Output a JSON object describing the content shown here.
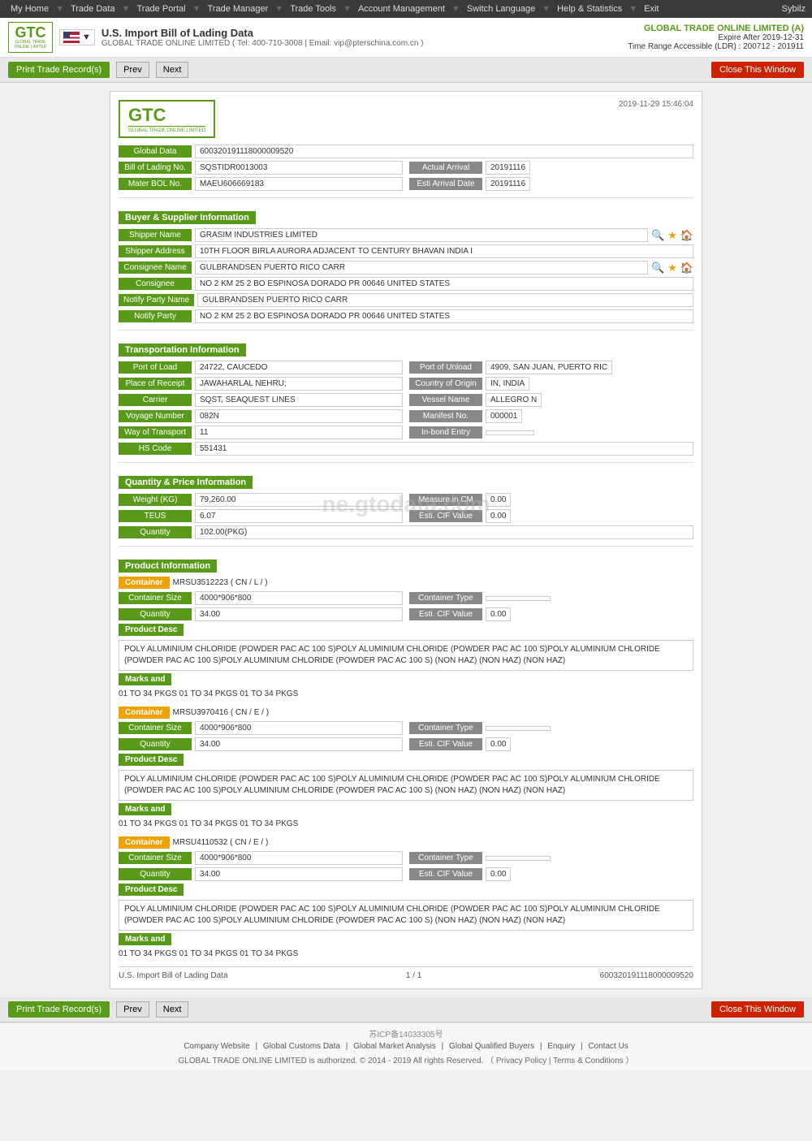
{
  "nav": {
    "items": [
      "My Home",
      "Trade Data",
      "Trade Portal",
      "Trade Manager",
      "Trade Tools",
      "Account Management",
      "Switch Language",
      "Help & Statistics",
      "Exit"
    ],
    "user": "Sybilz"
  },
  "header": {
    "logo_text": "GTC",
    "logo_sub": "GLOBAL TRADE ONLINE LIMITED",
    "title": "U.S. Import Bill of Lading Data",
    "subtitle": "GLOBAL TRADE ONLINE LIMITED ( Tel: 400-710-3008 | Email: vip@pterschina.com.cn )",
    "account_label": "GLOBAL TRADE ONLINE LIMITED (A)",
    "expire_label": "Expire After 2019-12-31",
    "time_range_label": "Time Range Accessible (LDR) : 200712 - 201911"
  },
  "toolbar": {
    "print_label": "Print Trade Record(s)",
    "prev_label": "Prev",
    "next_label": "Next",
    "close_label": "Close This Window"
  },
  "card": {
    "timestamp": "2019-11-29 15:46:04",
    "global_data_label": "Global Data",
    "global_data_value": "600320191118000009520",
    "bill_of_lading_label": "Bill of Lading No.",
    "bill_of_lading_value": "SQSTIDR0013003",
    "actual_arrival_label": "Actual Arrival",
    "actual_arrival_value": "20191116",
    "mater_bol_label": "Mater BOL No.",
    "mater_bol_value": "MAEU606669183",
    "esti_arrival_label": "Esti Arrival Date",
    "esti_arrival_value": "20191116",
    "buyer_supplier_section": "Buyer & Supplier Information",
    "shipper_name_label": "Shipper Name",
    "shipper_name_value": "GRASIM INDUSTRIES LIMITED",
    "shipper_address_label": "Shipper Address",
    "shipper_address_value": "10TH FLOOR BIRLA AURORA ADJACENT TO CENTURY BHAVAN INDIA I",
    "consignee_name_label": "Consignee Name",
    "consignee_name_value": "GULBRANDSEN PUERTO RICO CARR",
    "consignee_label": "Consignee",
    "consignee_value": "NO 2 KM 25 2 BO ESPINOSA DORADO PR 00646 UNITED STATES",
    "notify_party_name_label": "Notify Party Name",
    "notify_party_name_value": "GULBRANDSEN PUERTO RICO CARR",
    "notify_party_label": "Notify Party",
    "notify_party_value": "NO 2 KM 25 2 BO ESPINOSA DORADO PR 00646 UNITED STATES",
    "transport_section": "Transportation Information",
    "port_of_load_label": "Port of Load",
    "port_of_load_value": "24722, CAUCEDO",
    "port_of_unload_label": "Port of Unload",
    "port_of_unload_value": "4909, SAN JUAN, PUERTO RIC",
    "place_of_receipt_label": "Place of Receipt",
    "place_of_receipt_value": "JAWAHARLAL NEHRU;",
    "country_of_origin_label": "Country of Origin",
    "country_of_origin_value": "IN, INDIA",
    "carrier_label": "Carrier",
    "carrier_value": "SQST, SEAQUEST LINES",
    "vessel_name_label": "Vessel Name",
    "vessel_name_value": "ALLEGRO N",
    "voyage_number_label": "Voyage Number",
    "voyage_number_value": "082N",
    "manifest_no_label": "Manifest No.",
    "manifest_no_value": "000001",
    "way_of_transport_label": "Way of Transport",
    "way_of_transport_value": "11",
    "in_bond_entry_label": "In-bond Entry",
    "in_bond_entry_value": "",
    "hs_code_label": "HS Code",
    "hs_code_value": "551431",
    "quantity_section": "Quantity & Price Information",
    "weight_kg_label": "Weight (KG)",
    "weight_kg_value": "79,260.00",
    "measure_cm_label": "Measure in CM",
    "measure_cm_value": "0.00",
    "teus_label": "TEUS",
    "teus_value": "6.07",
    "esti_cif_label": "Esti. CIF Value",
    "esti_cif_value": "0.00",
    "quantity_label": "Quantity",
    "quantity_value": "102.00(PKG)",
    "watermark": "ne.gtodata.com",
    "product_section": "Product Information",
    "containers": [
      {
        "id": "MRSU3512223 ( CN / L / )",
        "size": "4000*906*800",
        "container_type_label": "Container Type",
        "container_type_value": "",
        "quantity": "34.00",
        "esti_cif": "0.00",
        "product_desc": "POLY ALUMINIUM CHLORIDE (POWDER PAC AC 100 S)POLY ALUMINIUM CHLORIDE (POWDER PAC AC 100 S)POLY ALUMINIUM CHLORIDE (POWDER PAC AC 100 S)POLY ALUMINIUM CHLORIDE (POWDER PAC AC 100 S) (NON HAZ) (NON HAZ) (NON HAZ)",
        "marks": "01 TO 34 PKGS 01 TO 34 PKGS 01 TO 34 PKGS"
      },
      {
        "id": "MRSU3970416 ( CN / E / )",
        "size": "4000*906*800",
        "container_type_label": "Container Type",
        "container_type_value": "",
        "quantity": "34.00",
        "esti_cif": "0.00",
        "product_desc": "POLY ALUMINIUM CHLORIDE (POWDER PAC AC 100 S)POLY ALUMINIUM CHLORIDE (POWDER PAC AC 100 S)POLY ALUMINIUM CHLORIDE (POWDER PAC AC 100 S)POLY ALUMINIUM CHLORIDE (POWDER PAC AC 100 S) (NON HAZ) (NON HAZ) (NON HAZ)",
        "marks": "01 TO 34 PKGS 01 TO 34 PKGS 01 TO 34 PKGS"
      },
      {
        "id": "MRSU4110532 ( CN / E / )",
        "size": "4000*906*800",
        "container_type_label": "Container Type",
        "container_type_value": "",
        "quantity": "34.00",
        "esti_cif": "0.00",
        "product_desc": "POLY ALUMINIUM CHLORIDE (POWDER PAC AC 100 S)POLY ALUMINIUM CHLORIDE (POWDER PAC AC 100 S)POLY ALUMINIUM CHLORIDE (POWDER PAC AC 100 S)POLY ALUMINIUM CHLORIDE (POWDER PAC AC 100 S) (NON HAZ) (NON HAZ) (NON HAZ)",
        "marks": "01 TO 34 PKGS 01 TO 34 PKGS 01 TO 34 PKGS"
      }
    ],
    "card_footer_left": "U.S. Import Bill of Lading Data",
    "card_footer_page": "1 / 1",
    "card_footer_id": "600320191118000009520"
  },
  "footer": {
    "icp": "苏ICP备14033305号",
    "links": [
      "Company Website",
      "Global Customs Data",
      "Global Market Analysis",
      "Global Qualified Buyers",
      "Enquiry",
      "Contact Us"
    ],
    "copyright": "GLOBAL TRADE ONLINE LIMITED is authorized. © 2014 - 2019 All rights Reserved. （ Privacy Policy | Terms & Conditions ）"
  }
}
